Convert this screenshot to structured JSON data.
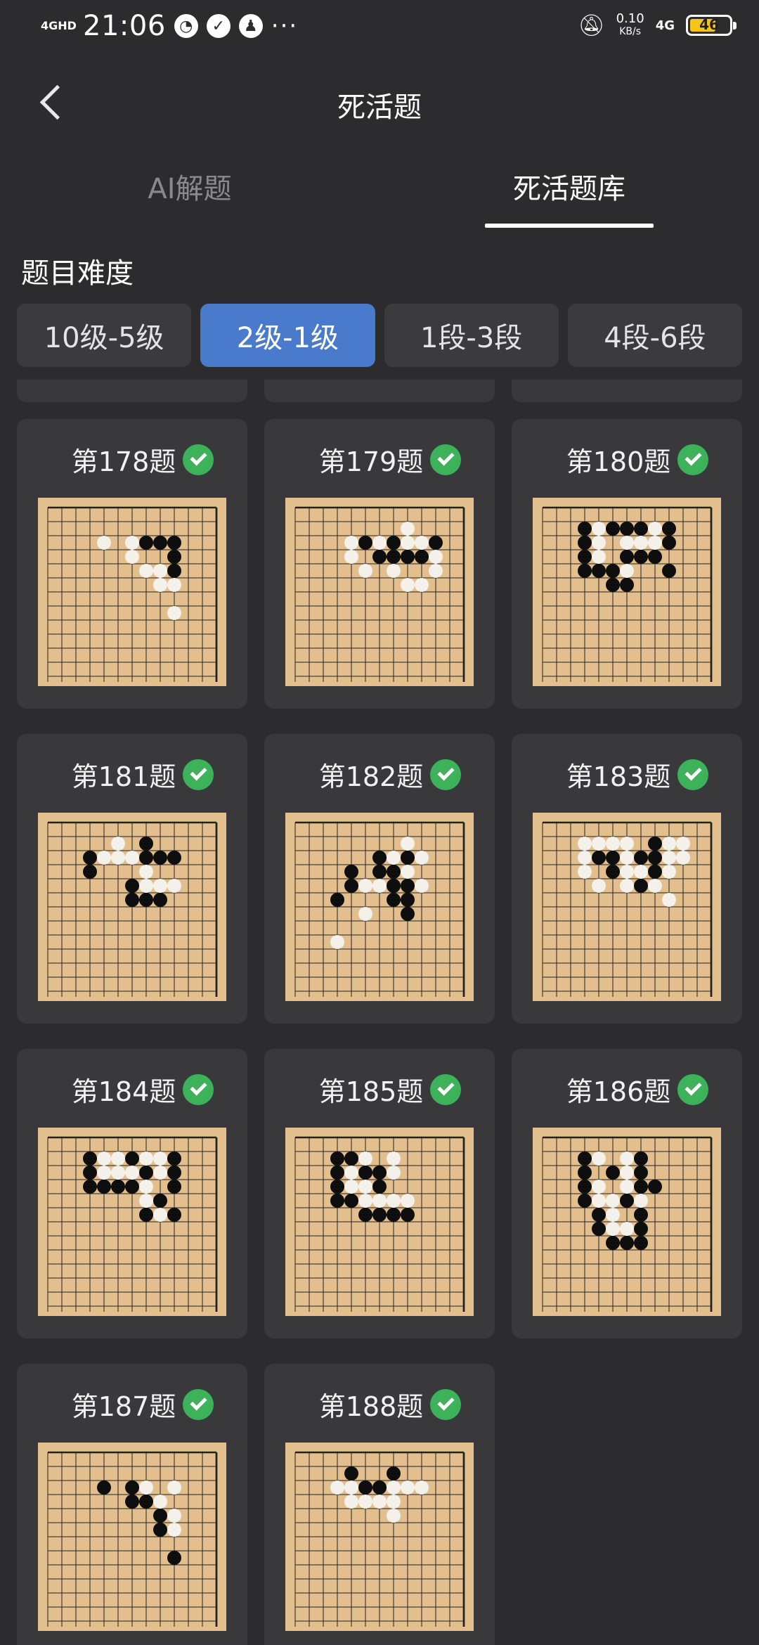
{
  "status_bar": {
    "network": "4GHD",
    "time": "21:06",
    "speed_value": "0.10",
    "speed_unit": "KB/s",
    "signal": "4G",
    "battery": "46",
    "battery_level": 0.46
  },
  "header": {
    "title": "死活题"
  },
  "tabs": [
    {
      "label": "AI解题",
      "active": false
    },
    {
      "label": "死活题库",
      "active": true
    }
  ],
  "difficulty": {
    "label": "题目难度",
    "options": [
      {
        "label": "10级-5级",
        "active": false
      },
      {
        "label": "2级-1级",
        "active": true
      },
      {
        "label": "1段-3段",
        "active": false
      },
      {
        "label": "4段-6段",
        "active": false
      }
    ]
  },
  "problems": [
    {
      "title": "第178题",
      "solved": true
    },
    {
      "title": "第179题",
      "solved": true
    },
    {
      "title": "第180题",
      "solved": true
    },
    {
      "title": "第181题",
      "solved": true
    },
    {
      "title": "第182题",
      "solved": true
    },
    {
      "title": "第183题",
      "solved": true
    },
    {
      "title": "第184题",
      "solved": true
    },
    {
      "title": "第185题",
      "solved": true
    },
    {
      "title": "第186题",
      "solved": true
    },
    {
      "title": "第187题",
      "solved": true
    },
    {
      "title": "第188题",
      "solved": true
    }
  ],
  "colors": {
    "background": "#2c2c2e",
    "card": "#39393b",
    "accent": "#4a7acb",
    "check": "#3db25a",
    "board": "#e4bf8e"
  }
}
